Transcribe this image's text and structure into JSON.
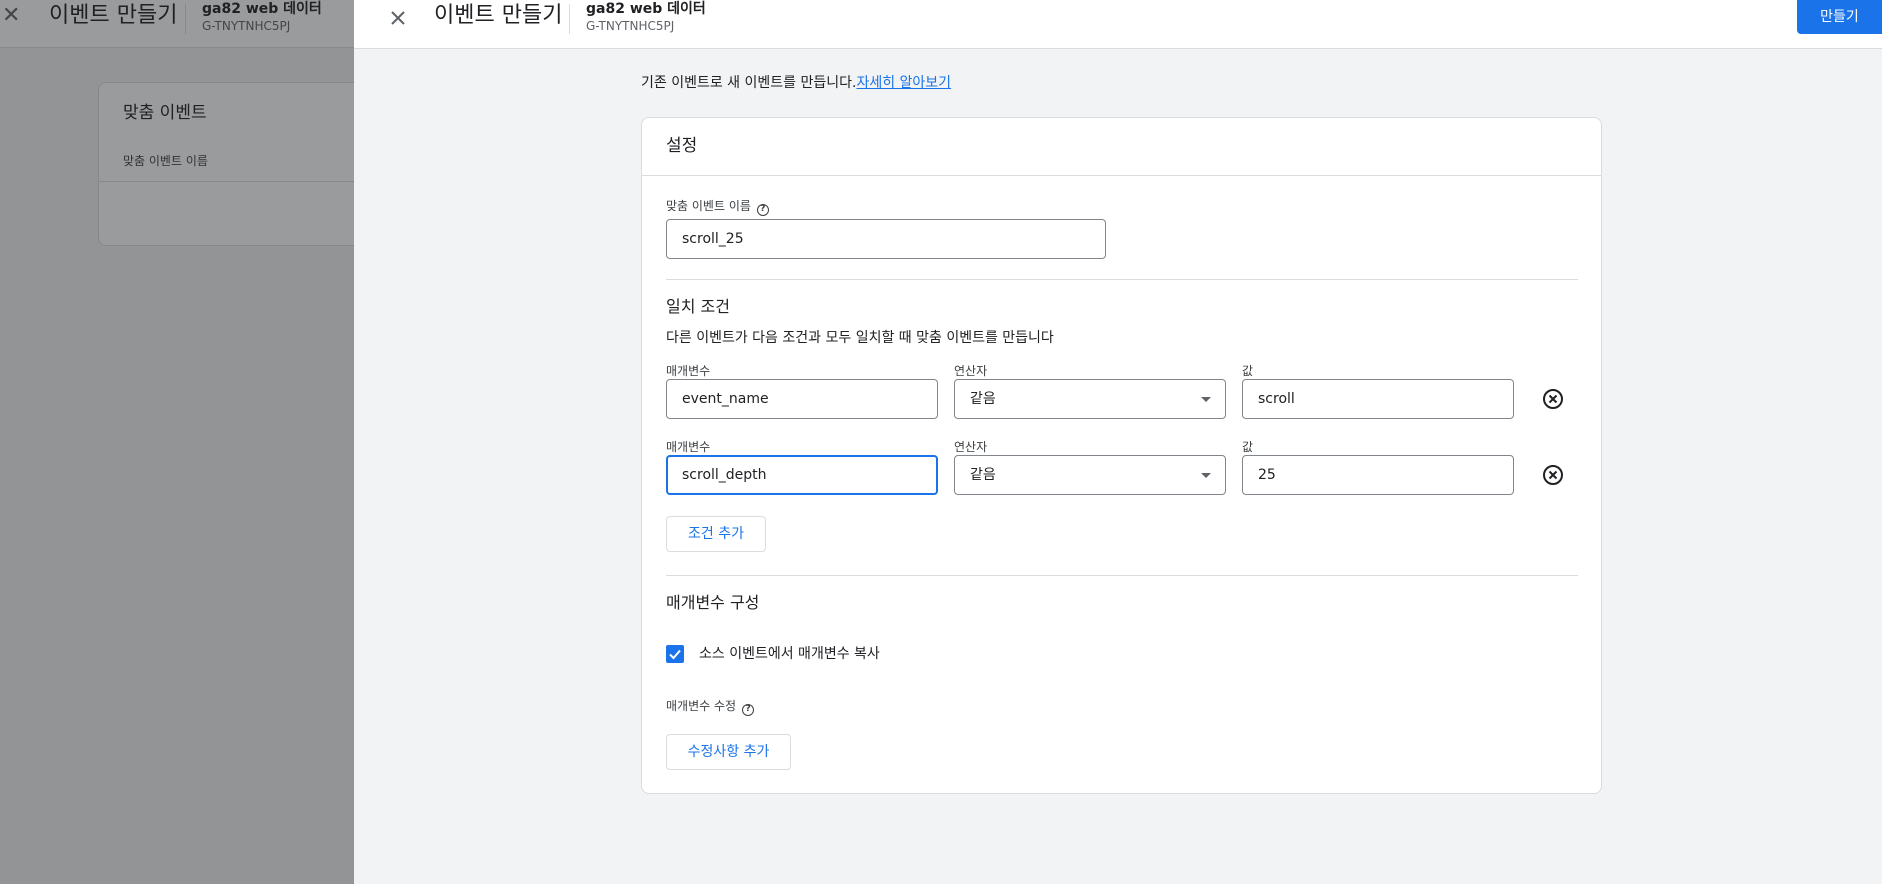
{
  "background": {
    "title": "이벤트 만들기",
    "property_name": "ga82 web 데이터",
    "property_id": "G-TNYTNHC5PJ",
    "card_title": "맞춤 이벤트",
    "card_label": "맞춤 이벤트 이름"
  },
  "header": {
    "title": "이벤트 만들기",
    "property_name": "ga82 web 데이터",
    "property_id": "G-TNYTNHC5PJ",
    "create_label": "만들기"
  },
  "intro": {
    "text": "기존 이벤트로 새 이벤트를 만듭니다.",
    "link": "자세히 알아보기"
  },
  "settings": {
    "title": "설정",
    "event_name_label": "맞춤 이벤트 이름",
    "event_name_value": "scroll_25"
  },
  "matching": {
    "title": "일치 조건",
    "description": "다른 이벤트가 다음 조건과 모두 일치할 때 맞춤 이벤트를 만듭니다",
    "conditions": [
      {
        "param_label": "매개변수",
        "param_value": "event_name",
        "operator_label": "연산자",
        "operator_value": "같음",
        "value_label": "값",
        "value": "scroll"
      },
      {
        "param_label": "매개변수",
        "param_value": "scroll_depth",
        "operator_label": "연산자",
        "operator_value": "같음",
        "value_label": "값",
        "value": "25"
      }
    ],
    "add_condition_label": "조건 추가"
  },
  "params": {
    "title": "매개변수 구성",
    "copy_label": "소스 이벤트에서 매개변수 복사",
    "copy_checked": true,
    "modify_label": "매개변수 수정",
    "add_modification_label": "수정사항 추가"
  },
  "colors": {
    "accent": "#1a73e8",
    "border": "#dadce0",
    "overlay": "#202124"
  }
}
